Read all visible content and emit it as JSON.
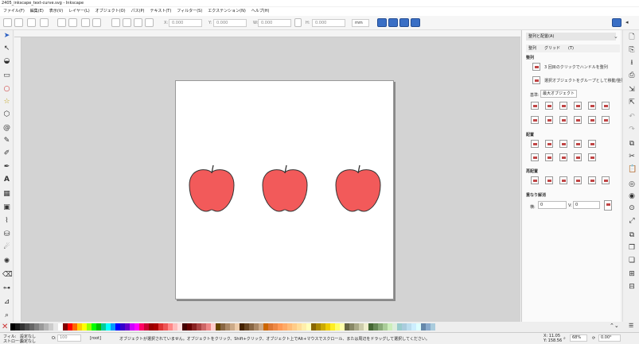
{
  "window": {
    "title": "2405_inkscape_text-curve.svg - Inkscape"
  },
  "menu": [
    "ファイル(F)",
    "編集(E)",
    "表示(V)",
    "レイヤー(L)",
    "オブジェクト(O)",
    "パス(P)",
    "テキスト(T)",
    "フィルター(S)",
    "エクステンション(N)",
    "ヘルプ(H)"
  ],
  "toolbar": {
    "x_label": "X:",
    "x_value": "0.000",
    "y_label": "Y:",
    "y_value": "0.000",
    "w_label": "W:",
    "w_value": "0.000",
    "h_label": "H:",
    "h_value": "0.000",
    "unit": "mm"
  },
  "dock": {
    "title": "整列と配置(A)",
    "tabs": [
      "整列",
      "グリッド",
      "(T)"
    ],
    "section_align": "整列",
    "opt1": "3 回目のクリックでハンドルを整列",
    "opt2": "選択オブジェクトをグループとして移動/整列",
    "relative_label": "基準:",
    "relative_value": "最大オブジェクト",
    "section_distribute": "配置",
    "section_rearrange": "再配置",
    "section_overlap": "重なり解消",
    "h_label": "横:",
    "h_value": "0",
    "v_label": "V:",
    "v_value": "0"
  },
  "status": {
    "fill_label": "フィル:",
    "fill_value": "設定なし",
    "stroke_label": "ストローク:",
    "stroke_value": "設定なし",
    "opacity_label": "O:",
    "opacity_value": "100",
    "layer": "[root]",
    "message": "オブジェクトが選択されていません。オブジェクトをクリック、Shift+クリック、オブジェクト上でAlt+マウスでスクロール、または周辺をドラッグして選択してください。",
    "x_coord": "X: 11.05",
    "y_coord": "Y: 158.56",
    "zoom": "68%",
    "rotation": "0.00°"
  },
  "colors": {
    "apple_fill": "#f25a5a",
    "stroke": "#333333",
    "accent": "#3a6fc5"
  }
}
